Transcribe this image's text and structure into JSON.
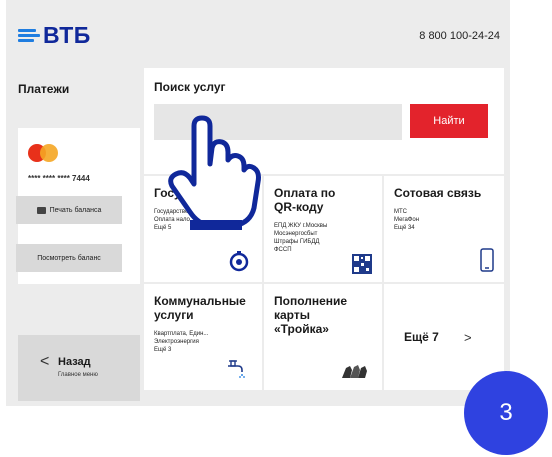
{
  "header": {
    "logo": "ВТБ",
    "phone": "8 800 100-24-24"
  },
  "left": {
    "title": "Платежи",
    "card_number": "**** **** **** 7444",
    "print_balance": "Печать баланса",
    "view_balance": "Посмотреть баланс"
  },
  "back": {
    "arrow": "<",
    "label": "Назад",
    "sub": "Главное меню"
  },
  "search": {
    "title": "Поиск услуг",
    "value": "",
    "button": "Найти"
  },
  "tiles": [
    {
      "title": "Госус",
      "lines": [
        "Государстве",
        "Оплата нало",
        "Ещё 5"
      ]
    },
    {
      "title_lines": [
        "Оплата по",
        "QR-коду"
      ],
      "lines": [
        "ЕПД ЖКУ г.Москвы",
        "Мосэнергосбыт",
        "Штрафы ГИБДД",
        "ФССП"
      ]
    },
    {
      "title": "Сотовая связь",
      "lines": [
        "МТС",
        "МегаФон",
        "Ещё 34"
      ]
    },
    {
      "title_lines": [
        "Коммунальные",
        "услуги"
      ],
      "lines": [
        "Квартплата, Един...",
        "Электроэнергия",
        "Ещё 3"
      ]
    },
    {
      "title_lines": [
        "Пополнение",
        "карты",
        "«Тройка»"
      ],
      "lines": []
    },
    {
      "title": "Ещё 7",
      "arrow": ">"
    }
  ],
  "step_badge": "3",
  "colors": {
    "accent": "#e3232c",
    "brand": "#10289a",
    "badge": "#2f42e0"
  },
  "icons": [
    "mastercard-icon",
    "printer-icon",
    "hand-pointer-icon",
    "timer-icon",
    "qr-code-icon",
    "phone-icon",
    "faucet-icon",
    "troika-horses-icon"
  ]
}
